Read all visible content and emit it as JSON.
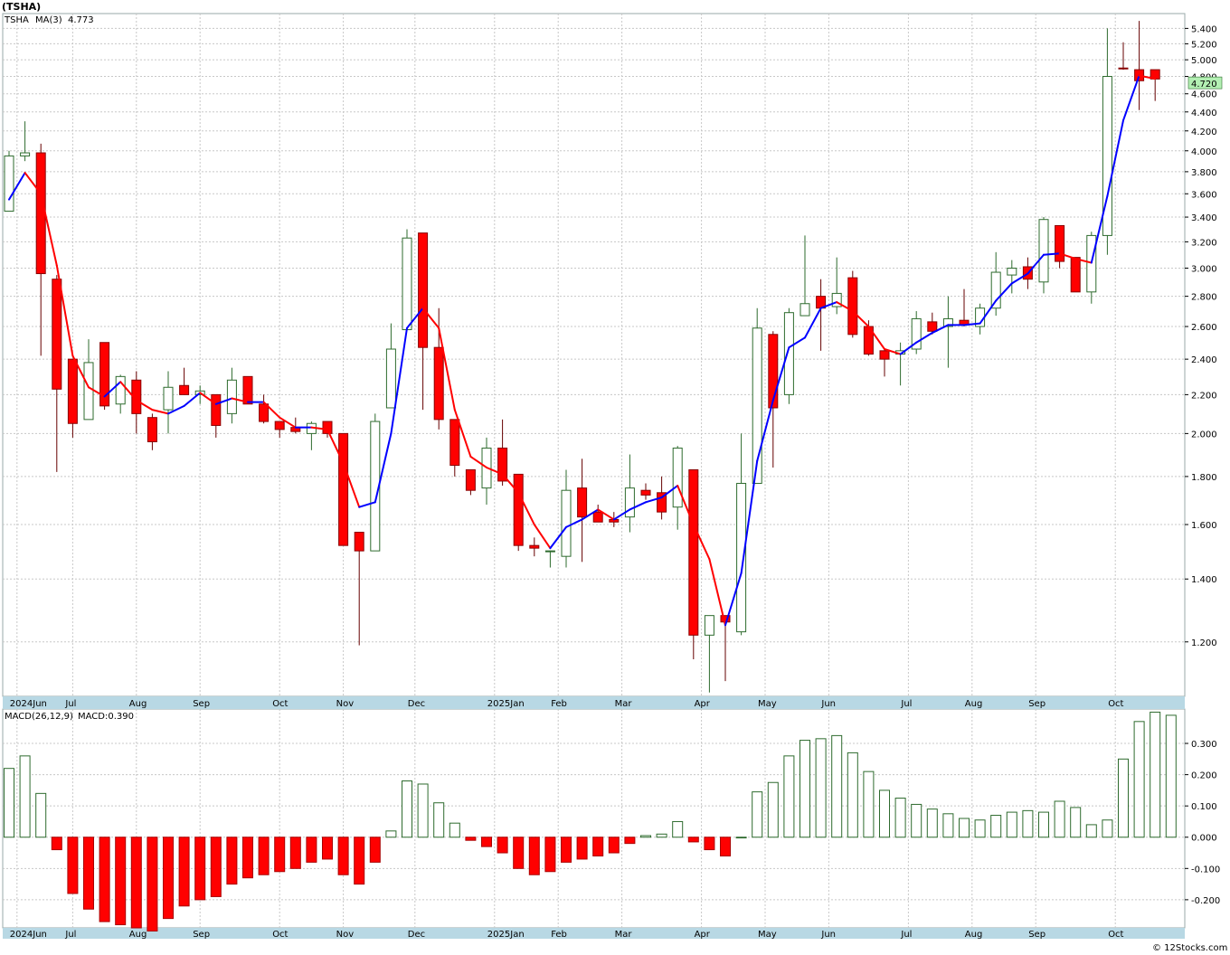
{
  "header": {
    "symbol": "(TSHA)"
  },
  "price_panel": {
    "legend_ticker": "TSHA",
    "legend_ma": "MA(3)",
    "legend_ma_value": "4.773",
    "last_price_label": "4.720"
  },
  "macd_panel": {
    "legend_params": "MACD(26,12,9)",
    "legend_value": "MACD:0.390"
  },
  "footer": {
    "credit": "© 12Stocks.com"
  },
  "colors": {
    "up": "#2e6b2e",
    "down": "#ff0000",
    "ma_up": "#0000ff",
    "ma_down": "#ff0000",
    "axis_band": "#b8d8e4",
    "last_price_bg": "#b3f0b3"
  },
  "chart_data": [
    {
      "type": "candlestick",
      "scale": "log",
      "ylim": [
        1.05,
        5.6
      ],
      "yticks": [
        "5.400",
        "5.200",
        "5.000",
        "4.800",
        "4.600",
        "4.400",
        "4.200",
        "4.000",
        "3.800",
        "3.600",
        "3.400",
        "3.200",
        "3.000",
        "2.800",
        "2.600",
        "2.400",
        "2.200",
        "2.000",
        "1.800",
        "1.600",
        "1.400",
        "1.200"
      ],
      "x_labels": [
        {
          "i": 0.5,
          "t": "2024Jun"
        },
        {
          "i": 4,
          "t": "Jul"
        },
        {
          "i": 8,
          "t": "Aug"
        },
        {
          "i": 12,
          "t": "Sep"
        },
        {
          "i": 17,
          "t": "Oct"
        },
        {
          "i": 21,
          "t": "Nov"
        },
        {
          "i": 25.5,
          "t": "Dec"
        },
        {
          "i": 30.5,
          "t": "2025Jan"
        },
        {
          "i": 34.5,
          "t": "Feb"
        },
        {
          "i": 38.5,
          "t": "Mar"
        },
        {
          "i": 43.5,
          "t": "Apr"
        },
        {
          "i": 47.5,
          "t": "May"
        },
        {
          "i": 51.5,
          "t": "Jun"
        },
        {
          "i": 56.5,
          "t": "Jul"
        },
        {
          "i": 60.5,
          "t": "Aug"
        },
        {
          "i": 64.5,
          "t": "Sep"
        },
        {
          "i": 69.5,
          "t": "Oct"
        }
      ],
      "candles": [
        [
          3.45,
          4.0,
          3.45,
          3.95
        ],
        [
          3.95,
          4.3,
          3.9,
          3.98
        ],
        [
          3.98,
          4.07,
          2.42,
          2.96
        ],
        [
          2.92,
          2.95,
          1.82,
          2.23
        ],
        [
          2.4,
          2.4,
          1.98,
          2.05
        ],
        [
          2.07,
          2.52,
          2.07,
          2.38
        ],
        [
          2.5,
          2.5,
          2.12,
          2.14
        ],
        [
          2.15,
          2.31,
          2.1,
          2.3
        ],
        [
          2.28,
          2.33,
          2.0,
          2.1
        ],
        [
          2.08,
          2.1,
          1.92,
          1.96
        ],
        [
          2.12,
          2.33,
          2.0,
          2.24
        ],
        [
          2.25,
          2.35,
          2.2,
          2.2
        ],
        [
          2.2,
          2.25,
          2.15,
          2.22
        ],
        [
          2.2,
          2.2,
          1.98,
          2.04
        ],
        [
          2.1,
          2.35,
          2.05,
          2.28
        ],
        [
          2.3,
          2.3,
          2.15,
          2.15
        ],
        [
          2.15,
          2.2,
          2.05,
          2.06
        ],
        [
          2.06,
          2.06,
          1.98,
          2.02
        ],
        [
          2.03,
          2.08,
          2.0,
          2.01
        ],
        [
          2.0,
          2.06,
          1.92,
          2.05
        ],
        [
          2.06,
          2.06,
          1.98,
          2.0
        ],
        [
          2.0,
          2.0,
          1.52,
          1.52
        ],
        [
          1.57,
          1.57,
          1.19,
          1.5
        ],
        [
          1.5,
          2.1,
          1.5,
          2.06
        ],
        [
          2.13,
          2.62,
          2.13,
          2.46
        ],
        [
          2.58,
          3.3,
          2.58,
          3.23
        ],
        [
          3.27,
          3.27,
          2.12,
          2.47
        ],
        [
          2.47,
          2.72,
          2.02,
          2.07
        ],
        [
          2.07,
          2.07,
          1.8,
          1.85
        ],
        [
          1.83,
          1.83,
          1.72,
          1.74
        ],
        [
          1.75,
          1.98,
          1.68,
          1.93
        ],
        [
          1.93,
          2.07,
          1.76,
          1.78
        ],
        [
          1.81,
          1.81,
          1.5,
          1.52
        ],
        [
          1.52,
          1.55,
          1.48,
          1.51
        ],
        [
          1.5,
          1.5,
          1.44,
          1.5
        ],
        [
          1.48,
          1.83,
          1.44,
          1.74
        ],
        [
          1.75,
          1.88,
          1.46,
          1.63
        ],
        [
          1.65,
          1.68,
          1.62,
          1.61
        ],
        [
          1.62,
          1.65,
          1.59,
          1.61
        ],
        [
          1.63,
          1.9,
          1.57,
          1.75
        ],
        [
          1.74,
          1.77,
          1.7,
          1.72
        ],
        [
          1.73,
          1.8,
          1.62,
          1.65
        ],
        [
          1.67,
          1.94,
          1.58,
          1.93
        ],
        [
          1.83,
          1.83,
          1.15,
          1.22
        ],
        [
          1.22,
          1.28,
          1.06,
          1.28
        ],
        [
          1.28,
          1.28,
          1.09,
          1.26
        ],
        [
          1.23,
          2.0,
          1.22,
          1.77
        ],
        [
          1.77,
          2.72,
          1.77,
          2.59
        ],
        [
          2.55,
          2.57,
          1.84,
          2.13
        ],
        [
          2.2,
          2.72,
          2.15,
          2.69
        ],
        [
          2.67,
          3.25,
          2.67,
          2.75
        ],
        [
          2.8,
          2.92,
          2.45,
          2.72
        ],
        [
          2.73,
          3.08,
          2.68,
          2.82
        ],
        [
          2.93,
          2.98,
          2.53,
          2.55
        ],
        [
          2.6,
          2.64,
          2.42,
          2.43
        ],
        [
          2.45,
          2.46,
          2.3,
          2.4
        ],
        [
          2.43,
          2.5,
          2.25,
          2.45
        ],
        [
          2.46,
          2.7,
          2.43,
          2.65
        ],
        [
          2.63,
          2.69,
          2.55,
          2.57
        ],
        [
          2.6,
          2.8,
          2.35,
          2.65
        ],
        [
          2.64,
          2.85,
          2.6,
          2.61
        ],
        [
          2.6,
          2.75,
          2.55,
          2.72
        ],
        [
          2.72,
          3.12,
          2.67,
          2.97
        ],
        [
          2.95,
          3.06,
          2.82,
          3.0
        ],
        [
          3.01,
          3.08,
          2.85,
          2.92
        ],
        [
          2.9,
          3.4,
          2.82,
          3.38
        ],
        [
          3.33,
          3.33,
          3.0,
          3.05
        ],
        [
          3.08,
          3.08,
          2.83,
          2.83
        ],
        [
          2.83,
          3.28,
          2.75,
          3.25
        ],
        [
          3.25,
          5.4,
          3.1,
          4.8
        ],
        [
          4.9,
          5.22,
          4.88,
          4.89
        ],
        [
          4.88,
          5.5,
          4.42,
          4.75
        ],
        [
          4.88,
          4.88,
          4.52,
          4.77
        ]
      ],
      "ma3": [
        3.55,
        3.79,
        3.6,
        3.02,
        2.42,
        2.24,
        2.19,
        2.27,
        2.17,
        2.12,
        2.1,
        2.14,
        2.21,
        2.15,
        2.18,
        2.16,
        2.16,
        2.08,
        2.03,
        2.03,
        2.02,
        1.86,
        1.67,
        1.69,
        2.0,
        2.59,
        2.72,
        2.59,
        2.12,
        1.89,
        1.84,
        1.81,
        1.73,
        1.6,
        1.51,
        1.59,
        1.62,
        1.66,
        1.62,
        1.66,
        1.69,
        1.71,
        1.76,
        1.6,
        1.47,
        1.25,
        1.42,
        1.87,
        2.17,
        2.47,
        2.53,
        2.72,
        2.76,
        2.7,
        2.6,
        2.46,
        2.43,
        2.5,
        2.56,
        2.61,
        2.61,
        2.62,
        2.77,
        2.89,
        2.96,
        3.1,
        3.11,
        3.07,
        3.04,
        3.58,
        4.31,
        4.81,
        4.773
      ]
    },
    {
      "type": "bar",
      "title": "MACD(26,12,9)",
      "ylim": [
        -0.29,
        0.41
      ],
      "yticks": [
        "0.300",
        "0.200",
        "0.100",
        "0.000",
        "-0.100",
        "-0.200"
      ],
      "values": [
        0.22,
        0.26,
        0.14,
        -0.04,
        -0.18,
        -0.23,
        -0.27,
        -0.28,
        -0.29,
        -0.3,
        -0.26,
        -0.22,
        -0.2,
        -0.19,
        -0.15,
        -0.13,
        -0.12,
        -0.11,
        -0.1,
        -0.08,
        -0.07,
        -0.12,
        -0.15,
        -0.08,
        0.02,
        0.18,
        0.17,
        0.11,
        0.045,
        -0.01,
        -0.03,
        -0.05,
        -0.1,
        -0.12,
        -0.11,
        -0.08,
        -0.07,
        -0.06,
        -0.05,
        -0.02,
        0.005,
        0.01,
        0.05,
        -0.015,
        -0.04,
        -0.06,
        0.0,
        0.145,
        0.175,
        0.26,
        0.31,
        0.315,
        0.325,
        0.27,
        0.21,
        0.15,
        0.125,
        0.105,
        0.09,
        0.075,
        0.06,
        0.055,
        0.07,
        0.08,
        0.085,
        0.08,
        0.115,
        0.095,
        0.04,
        0.055,
        0.25,
        0.37,
        0.4,
        0.39
      ]
    }
  ]
}
